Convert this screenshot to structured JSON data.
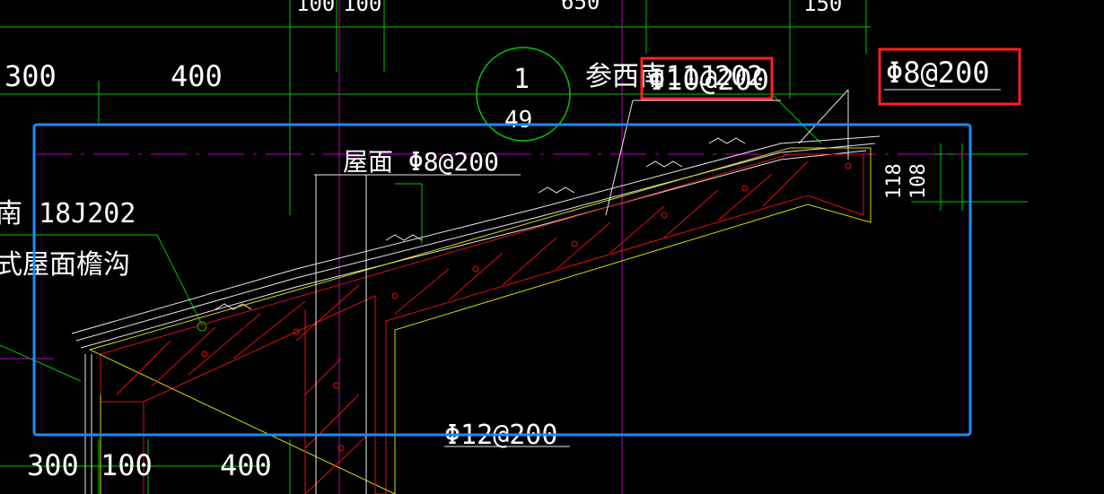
{
  "dimensions": {
    "top_row": [
      "100",
      "100",
      "650",
      "150"
    ],
    "upper_left": [
      "300",
      "400"
    ],
    "bottom_row": [
      "300",
      "100",
      "400"
    ],
    "right_vertical": [
      "118",
      "108"
    ]
  },
  "detail_callout": {
    "number": "1",
    "sheet": "49",
    "ref_label": "参西南11J202"
  },
  "rebar_labels": {
    "top_red_box": "Φ10@200",
    "top_right_box": "Φ8@200",
    "roof": "屋面 Φ8@200",
    "bottom": "Φ12@200"
  },
  "left_notes": {
    "atlas": "南 18J202",
    "gutter": "式屋面檐沟"
  },
  "highlights": {
    "red_box_color": "#ff2020",
    "blue_box_color": "#1a8cff"
  }
}
